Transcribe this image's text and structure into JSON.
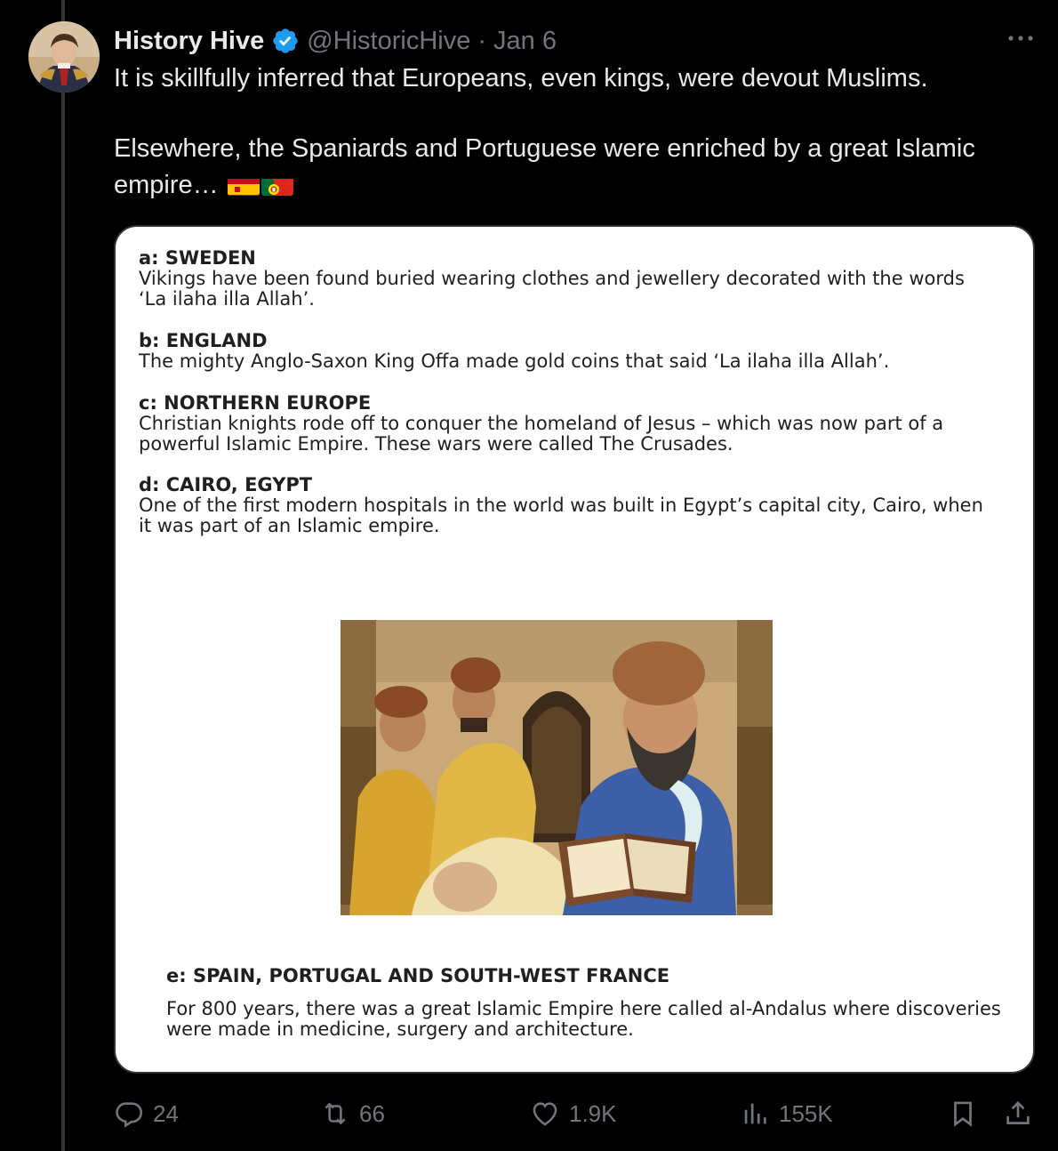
{
  "author": {
    "name": "History Hive",
    "handle": "@HistoricHive",
    "separator": "·",
    "date": "Jan 6"
  },
  "tweet": {
    "line1": "It is skillfully inferred that Europeans, even kings, were devout Muslims.",
    "line2": "Elsewhere, the Spaniards and Portuguese were enriched by a great Islamic empire…",
    "flags": [
      "spain-flag",
      "portugal-flag"
    ]
  },
  "card": {
    "entries": [
      {
        "heading": "a: SWEDEN",
        "text": "Vikings have been found buried wearing clothes and jewellery decorated with the words ‘La ilaha illa Allah’."
      },
      {
        "heading": "b: ENGLAND",
        "text": "The mighty Anglo-Saxon King Offa made gold coins that said ‘La ilaha illa Allah’."
      },
      {
        "heading": "c: NORTHERN EUROPE",
        "text": "Christian knights rode off to conquer the homeland of Jesus – which was now part of a powerful Islamic Empire. These wars were called The Crusades."
      },
      {
        "heading": "d: CAIRO, EGYPT",
        "text": "One of the first modern hospitals in the world was built in Egypt’s capital city, Cairo, when it was part of an Islamic empire."
      },
      {
        "heading": "e: SPAIN, PORTUGAL AND SOUTH-WEST FRANCE",
        "text": "For 800 years, there was a great Islamic Empire here called al-Andalus where discoveries were made in medicine, surgery and architecture."
      }
    ]
  },
  "actions": {
    "replies": "24",
    "reposts": "66",
    "likes": "1.9K",
    "views": "155K"
  },
  "colors": {
    "background": "#000000",
    "text": "#e7e9ea",
    "muted": "#71767b",
    "verified": "#1d9bf0"
  }
}
